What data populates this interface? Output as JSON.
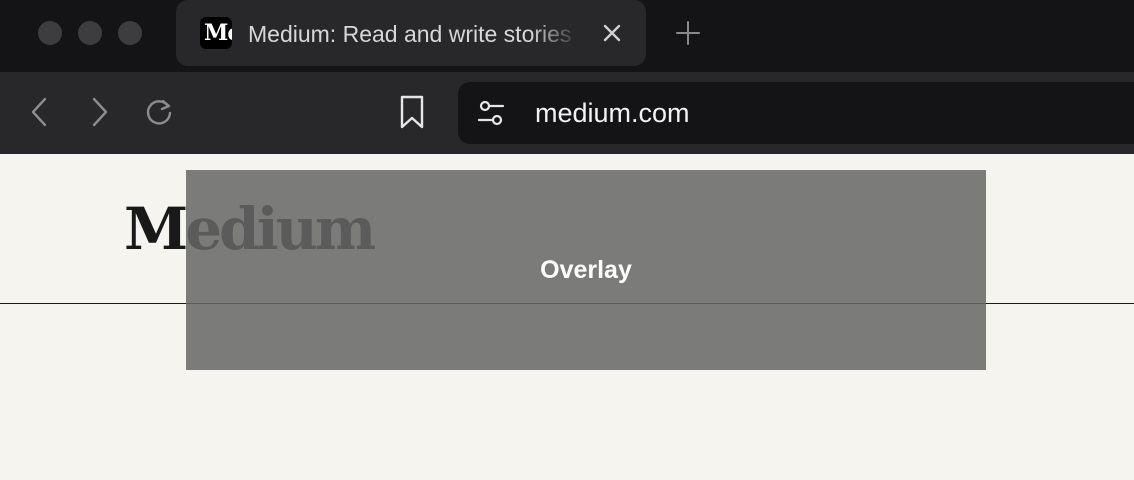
{
  "window": {
    "title": "Medium: Read and write stories"
  },
  "tab": {
    "favicon_text": "Medium",
    "favicon_icon": "medium-favicon",
    "title": "Medium: Read and write stories",
    "close_icon": "close-icon"
  },
  "tabstrip": {
    "new_tab_icon": "plus-icon"
  },
  "toolbar": {
    "back_icon": "chevron-left-icon",
    "forward_icon": "chevron-right-icon",
    "reload_icon": "reload-icon",
    "bookmark_icon": "bookmark-icon",
    "site_settings_icon": "sliders-icon"
  },
  "address_bar": {
    "url": "medium.com"
  },
  "page": {
    "logo": "Medium",
    "overlay_label": "Overlay"
  },
  "colors": {
    "tabstrip_bg": "#141416",
    "toolbar_bg": "#28282b",
    "page_bg": "#f6f4ee",
    "overlay_bg": "#666666",
    "logo_color": "#191919"
  }
}
